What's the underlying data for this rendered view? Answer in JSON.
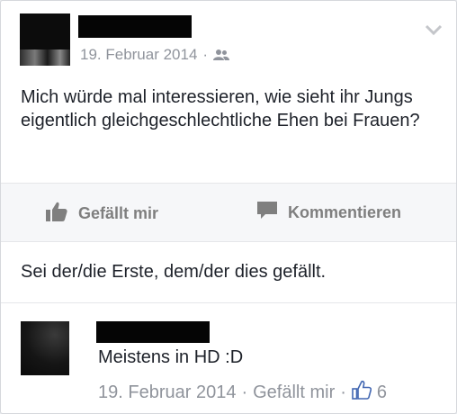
{
  "post": {
    "date": "19. Februar 2014",
    "separator": "·",
    "audience_icon": "friends-icon",
    "text": "Mich würde mal interessieren, wie sieht ihr Jungs eigentlich gleichgeschlechtliche Ehen bei Frauen?"
  },
  "actions": {
    "like_label": "Gefällt mir",
    "comment_label": "Kommentieren"
  },
  "likes_summary": "Sei der/die Erste, dem/der dies gefällt.",
  "comment": {
    "text": "Meistens in HD :D",
    "date": "19. Februar 2014",
    "separator": "·",
    "like_label": "Gefällt mir",
    "like_count": "6"
  },
  "colors": {
    "text": "#1d2129",
    "meta": "#90949c",
    "action": "#7f7f7f"
  }
}
